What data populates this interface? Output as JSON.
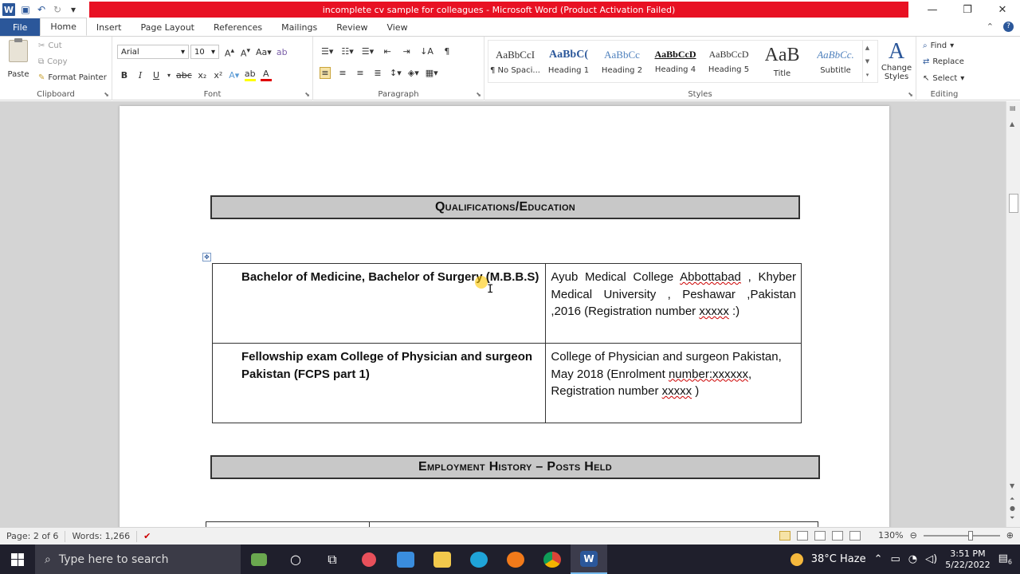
{
  "window": {
    "title": "incomplete cv sample for colleagues  -  Microsoft Word (Product Activation Failed)"
  },
  "tabs": [
    "File",
    "Home",
    "Insert",
    "Page Layout",
    "References",
    "Mailings",
    "Review",
    "View"
  ],
  "clipboard": {
    "paste": "Paste",
    "cut": "Cut",
    "copy": "Copy",
    "format_painter": "Format Painter",
    "label": "Clipboard"
  },
  "font": {
    "name": "Arial",
    "size": "10",
    "label": "Font",
    "bold": "B",
    "italic": "I",
    "underline": "U",
    "strike": "abc",
    "subscript": "x₂",
    "superscript": "x²"
  },
  "paragraph": {
    "label": "Paragraph",
    "pilcrow": "¶"
  },
  "styles": {
    "label": "Styles",
    "items": [
      {
        "sample": "AaBbCcI",
        "name": "¶ No Spaci..."
      },
      {
        "sample": "AaBbC(",
        "name": "Heading 1"
      },
      {
        "sample": "AaBbCc",
        "name": "Heading 2"
      },
      {
        "sample": "AaBbCcD",
        "name": "Heading 4"
      },
      {
        "sample": "AaBbCcD",
        "name": "Heading 5"
      },
      {
        "sample": "AaB",
        "name": "Title"
      },
      {
        "sample": "AaBbCc.",
        "name": "Subtitle"
      }
    ],
    "change_styles": "Change Styles"
  },
  "editing": {
    "label": "Editing",
    "find": "Find",
    "replace": "Replace",
    "select": "Select"
  },
  "document": {
    "qualifications_heading": "Qualifications/Education",
    "employment_heading": "Employment History – Posts Held",
    "education_rows": [
      {
        "degree": "Bachelor of Medicine, Bachelor of Surgery (M.B.B.S)",
        "institution_parts": [
          " Ayub Medical College ",
          "Abbottabad",
          " , Khyber Medical University , Peshawar ,Pakistan ,2016  (Registration number ",
          "xxxxx",
          " :)"
        ]
      },
      {
        "degree": "Fellowship exam College of Physician and surgeon Pakistan (FCPS part 1)",
        "institution_parts": [
          "College of Physician and surgeon Pakistan, May 2018 (Enrolment ",
          "number:xxxxxx",
          ", Registration number ",
          "xxxxx",
          " )"
        ]
      }
    ]
  },
  "status": {
    "page": "Page: 2 of 6",
    "words": "Words: 1,266",
    "zoom": "130%"
  },
  "taskbar": {
    "search_placeholder": "Type here to search",
    "weather": "38°C  Haze",
    "time": "3:51 PM",
    "date": "5/22/2022",
    "notification_count": "6"
  }
}
